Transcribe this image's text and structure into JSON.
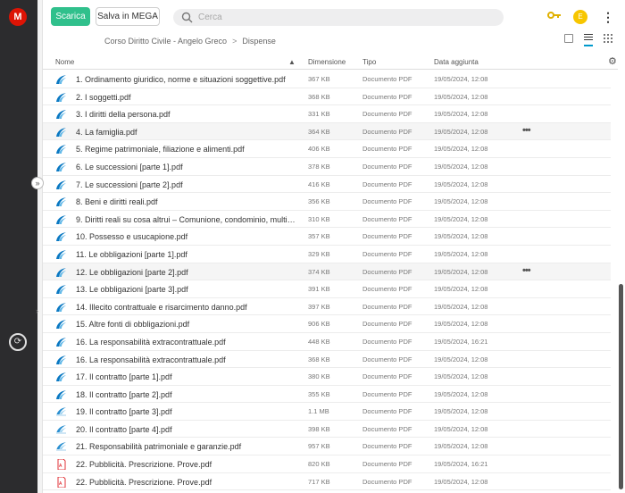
{
  "brand": {
    "logo_letter": "M",
    "color": "#dd1405"
  },
  "toolbar": {
    "download_label": "Scarica",
    "save_label": "Salva in MEGA",
    "search_placeholder": "Cerca",
    "avatar_letter": "E"
  },
  "breadcrumb": {
    "items": [
      "Corso Diritto Civile - Angelo Greco",
      "Dispense"
    ],
    "separator": ">"
  },
  "table": {
    "headers": {
      "name": "Nome",
      "size": "Dimensione",
      "type": "Tipo",
      "date": "Data aggiunta"
    },
    "rows": [
      {
        "name": "1. Ordinamento giuridico, norme e situazioni soggettive.pdf",
        "size": "367 KB",
        "type": "Documento PDF",
        "date": "19/05/2024, 12:08",
        "icon": "mega-file-icon"
      },
      {
        "name": "2. I soggetti.pdf",
        "size": "368 KB",
        "type": "Documento PDF",
        "date": "19/05/2024, 12:08",
        "icon": "mega-file-icon"
      },
      {
        "name": "3. I diritti della persona.pdf",
        "size": "331 KB",
        "type": "Documento PDF",
        "date": "19/05/2024, 12:08",
        "icon": "mega-file-icon"
      },
      {
        "name": "4. La famiglia.pdf",
        "size": "364 KB",
        "type": "Documento PDF",
        "date": "19/05/2024, 12:08",
        "icon": "mega-file-icon",
        "more": "•••"
      },
      {
        "name": "5. Regime patrimoniale, filiazione e alimenti.pdf",
        "size": "406 KB",
        "type": "Documento PDF",
        "date": "19/05/2024, 12:08",
        "icon": "mega-file-icon"
      },
      {
        "name": "6. Le successioni [parte 1].pdf",
        "size": "378 KB",
        "type": "Documento PDF",
        "date": "19/05/2024, 12:08",
        "icon": "mega-file-icon"
      },
      {
        "name": "7. Le successioni [parte 2].pdf",
        "size": "416 KB",
        "type": "Documento PDF",
        "date": "19/05/2024, 12:08",
        "icon": "mega-file-icon"
      },
      {
        "name": "8. Beni e diritti reali.pdf",
        "size": "356 KB",
        "type": "Documento PDF",
        "date": "19/05/2024, 12:08",
        "icon": "mega-file-icon"
      },
      {
        "name": "9. Diritti reali su cosa altrui – Comunione, condominio, multiprop...",
        "size": "310 KB",
        "type": "Documento PDF",
        "date": "19/05/2024, 12:08",
        "icon": "mega-file-icon"
      },
      {
        "name": "10. Possesso e usucapione.pdf",
        "size": "357 KB",
        "type": "Documento PDF",
        "date": "19/05/2024, 12:08",
        "icon": "mega-file-icon"
      },
      {
        "name": "11. Le obbligazioni [parte 1].pdf",
        "size": "329 KB",
        "type": "Documento PDF",
        "date": "19/05/2024, 12:08",
        "icon": "mega-file-icon"
      },
      {
        "name": "12. Le obbligazioni [parte 2].pdf",
        "size": "374 KB",
        "type": "Documento PDF",
        "date": "19/05/2024, 12:08",
        "icon": "mega-file-icon",
        "more": "•••"
      },
      {
        "name": "13. Le obbligazioni [parte 3].pdf",
        "size": "391 KB",
        "type": "Documento PDF",
        "date": "19/05/2024, 12:08",
        "icon": "mega-file-icon"
      },
      {
        "name": "14. Illecito contrattuale e risarcimento danno.pdf",
        "size": "397 KB",
        "type": "Documento PDF",
        "date": "19/05/2024, 12:08",
        "icon": "mega-file-icon"
      },
      {
        "name": "15. Altre fonti di obbligazioni.pdf",
        "size": "906 KB",
        "type": "Documento PDF",
        "date": "19/05/2024, 12:08",
        "icon": "mega-file-icon"
      },
      {
        "name": "16. La responsabilità extracontrattuale.pdf",
        "size": "448 KB",
        "type": "Documento PDF",
        "date": "19/05/2024, 16:21",
        "icon": "mega-file-icon"
      },
      {
        "name": "16. La responsabilità extracontrattuale.pdf",
        "size": "368 KB",
        "type": "Documento PDF",
        "date": "19/05/2024, 12:08",
        "icon": "mega-file-icon"
      },
      {
        "name": "17. Il contratto [parte 1].pdf",
        "size": "380 KB",
        "type": "Documento PDF",
        "date": "19/05/2024, 12:08",
        "icon": "mega-file-icon"
      },
      {
        "name": "18. Il contratto [parte 2].pdf",
        "size": "355 KB",
        "type": "Documento PDF",
        "date": "19/05/2024, 12:08",
        "icon": "mega-file-icon"
      },
      {
        "name": "19. Il contratto [parte 3].pdf",
        "size": "1.1 MB",
        "type": "Documento PDF",
        "date": "19/05/2024, 12:08",
        "icon": "mega-file-icon-alt"
      },
      {
        "name": "20. Il contratto [parte 4].pdf",
        "size": "398 KB",
        "type": "Documento PDF",
        "date": "19/05/2024, 12:08",
        "icon": "mega-file-icon-alt"
      },
      {
        "name": "21. Responsabilità patrimoniale e garanzie.pdf",
        "size": "957 KB",
        "type": "Documento PDF",
        "date": "19/05/2024, 12:08",
        "icon": "mega-file-icon-alt"
      },
      {
        "name": "22. Pubblicità. Prescrizione. Prove.pdf",
        "size": "820 KB",
        "type": "Documento PDF",
        "date": "19/05/2024, 16:21",
        "icon": "pdf-icon"
      },
      {
        "name": "22. Pubblicità. Prescrizione. Prove.pdf",
        "size": "717 KB",
        "type": "Documento PDF",
        "date": "19/05/2024, 12:08",
        "icon": "pdf-icon"
      }
    ]
  },
  "colors": {
    "accent": "#30c08c",
    "rail": "#2c2c2e",
    "link_blue": "#0099cc",
    "pdf_red": "#d90007"
  }
}
